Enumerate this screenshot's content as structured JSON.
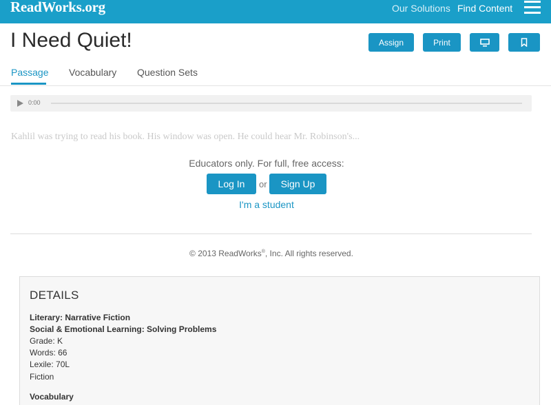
{
  "header": {
    "logo": "ReadWorks.org",
    "nav": [
      "Our Solutions",
      "Find Content"
    ]
  },
  "page": {
    "title": "I Need Quiet!",
    "actions": {
      "assign": "Assign",
      "print": "Print"
    }
  },
  "tabs": [
    "Passage",
    "Vocabulary",
    "Question Sets"
  ],
  "audio": {
    "time": "0:00"
  },
  "passage": {
    "teaser": "Kahlil was trying to read his book. His window was open. He could hear Mr. Robinson's..."
  },
  "access": {
    "message": "Educators only. For full, free access:",
    "login": "Log In",
    "or": "or",
    "signup": "Sign Up",
    "student": "I'm a student"
  },
  "footer": {
    "copyright_prefix": "© 2013 ReadWorks",
    "copyright_mark": "®",
    "copyright_suffix": ", Inc. All rights reserved."
  },
  "details": {
    "title": "DETAILS",
    "genre": "Literary: Narrative Fiction",
    "sel": "Social & Emotional Learning: Solving Problems",
    "grade": "Grade: K",
    "words": "Words: 66",
    "lexile": "Lexile: 70L",
    "type": "Fiction",
    "vocab_heading": "Vocabulary"
  },
  "colors": {
    "brand": "#1a9fc9",
    "button": "#1a95c4"
  },
  "icons": {
    "menu": "hamburger-icon",
    "present": "monitor-icon",
    "bookmark": "bookmark-icon",
    "play": "play-icon"
  }
}
